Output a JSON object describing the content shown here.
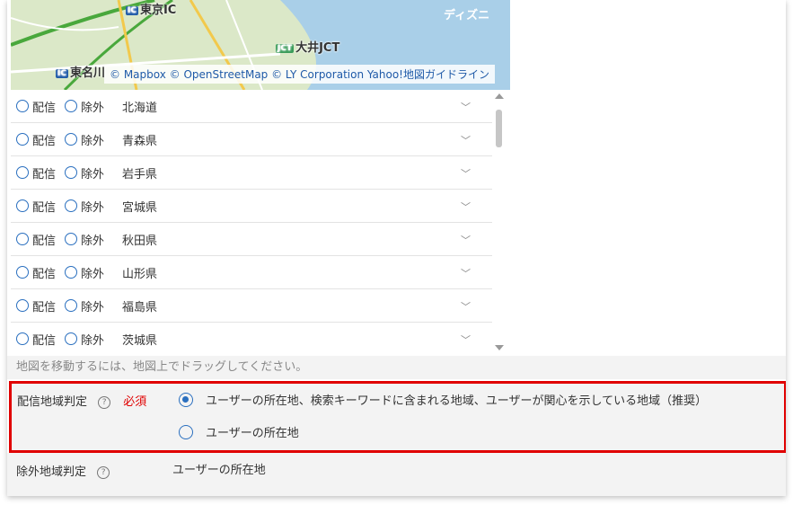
{
  "map": {
    "labels": {
      "tokyo_ic": "東京IC",
      "ohi_jct": "大井JCT",
      "tomei": "東名川",
      "disney": "ディズニ"
    },
    "badges": {
      "ic": "IC",
      "jct": "JCT"
    },
    "attribution": "© Mapbox © OpenStreetMap © LY Corporation Yahoo!地図ガイドライン"
  },
  "list": {
    "option_deliver": "配信",
    "option_exclude": "除外",
    "prefectures": [
      "北海道",
      "青森県",
      "岩手県",
      "宮城県",
      "秋田県",
      "山形県",
      "福島県",
      "茨城県"
    ]
  },
  "hint": "地図を移動するには、地図上でドラッグしてください。",
  "delivery_judgement": {
    "label": "配信地域判定",
    "help": "?",
    "required": "必須",
    "options": [
      {
        "label": "ユーザーの所在地、検索キーワードに含まれる地域、ユーザーが関心を示している地域（推奨）",
        "selected": true
      },
      {
        "label": "ユーザーの所在地",
        "selected": false
      }
    ]
  },
  "exclusion_judgement": {
    "label": "除外地域判定",
    "help": "?",
    "value": "ユーザーの所在地"
  },
  "colors": {
    "accent": "#2a6fbf",
    "required": "#e00000",
    "highlight": "#e00000"
  }
}
